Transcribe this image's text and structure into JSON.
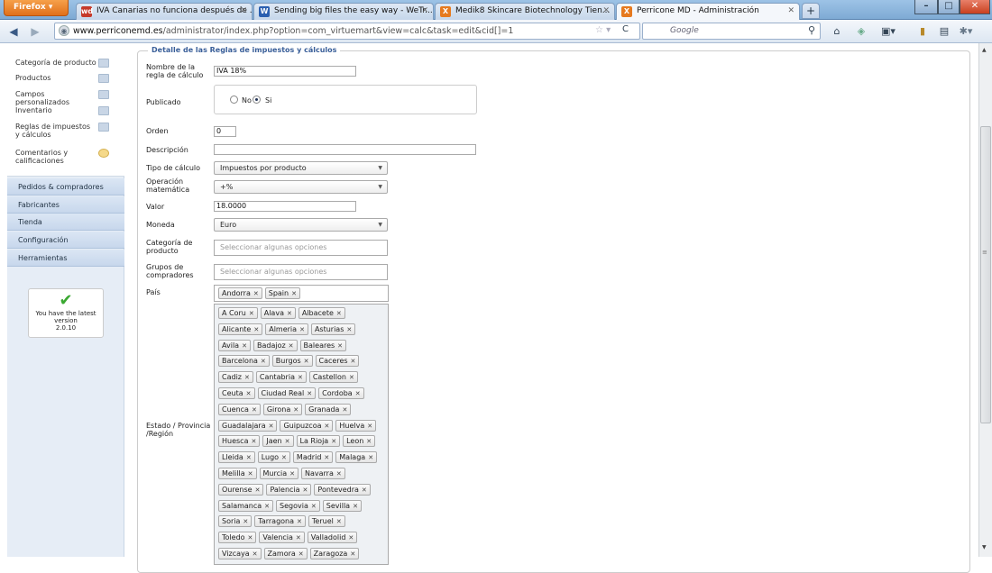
{
  "browser": {
    "menu_button": "Firefox ▾",
    "tabs": [
      {
        "title": "IVA Canarias no funciona después de ...",
        "icon": "wd",
        "color": "#c63a2a"
      },
      {
        "title": "Sending big files the easy way - WeTr...",
        "icon": "W",
        "color": "#2a5fb0"
      },
      {
        "title": "Medik8 Skincare Biotechnology Tien...",
        "icon": "X",
        "color": "#e67a1f"
      },
      {
        "title": "Perricone MD - Administración",
        "icon": "X",
        "color": "#e67a1f",
        "active": true
      }
    ],
    "new_tab": "+",
    "window_controls": [
      "–",
      "□",
      "✕"
    ],
    "url_host": "www.perriconemd.es",
    "url_path": "/administrator/index.php?option=com_virtuemart&view=calc&task=edit&cid[]=1",
    "search_placeholder": "Google",
    "toolbar_icons": [
      "home-icon",
      "addon-icon",
      "bookmarks-menu-icon",
      "library-icon",
      "screenshot-icon",
      "tools-icon"
    ]
  },
  "sidebar": {
    "product_items": [
      {
        "label": "Categoría de producto"
      },
      {
        "label": "Productos"
      },
      {
        "label": "Campos personalizados"
      },
      {
        "label": "Inventario"
      },
      {
        "label": "Reglas de impuestos y cálculos"
      },
      {
        "label": "Comentarios y calificaciones"
      }
    ],
    "sections": [
      "Pedidos & compradores",
      "Fabricantes",
      "Tienda",
      "Configuración",
      "Herramientas"
    ],
    "version_text": "You have the latest version",
    "version_number": "2.0.10"
  },
  "form": {
    "legend": "Detalle de las Reglas de impuestos y cálculos",
    "name": {
      "label": "Nombre de la regla de cálculo",
      "value": "IVA 18%"
    },
    "published": {
      "label": "Publicado",
      "no_label": "No",
      "yes_label": "Si",
      "selected": "Si"
    },
    "order": {
      "label": "Orden",
      "value": "0"
    },
    "description": {
      "label": "Descripción",
      "value": ""
    },
    "calc_type": {
      "label": "Tipo de cálculo",
      "value": "Impuestos por producto"
    },
    "math_op": {
      "label": "Operación matemática",
      "value": "+%"
    },
    "value": {
      "label": "Valor",
      "value": "18.0000"
    },
    "currency": {
      "label": "Moneda",
      "value": "Euro"
    },
    "product_category": {
      "label": "Categoría de producto",
      "placeholder": "Seleccionar algunas opciones"
    },
    "shopper_groups": {
      "label": "Grupos de compradores",
      "placeholder": "Seleccionar algunas opciones"
    },
    "country": {
      "label": "País",
      "chips": [
        "Andorra",
        "Spain"
      ]
    },
    "region": {
      "label": "Estado / Provincia /Región",
      "rows": [
        [
          "A Coru",
          "Alava",
          "Albacete"
        ],
        [
          "Alicante",
          "Almeria",
          "Asturias"
        ],
        [
          "Avila",
          "Badajoz",
          "Baleares"
        ],
        [
          "Barcelona",
          "Burgos",
          "Caceres"
        ],
        [
          "Cadiz",
          "Cantabria",
          "Castellon"
        ],
        [
          "Ceuta",
          "Ciudad Real",
          "Cordoba"
        ],
        [
          "Cuenca",
          "Girona",
          "Granada"
        ],
        [
          "Guadalajara",
          "Guipuzcoa",
          "Huelva"
        ],
        [
          "Huesca",
          "Jaen",
          "La Rioja",
          "Leon"
        ],
        [
          "Lleida",
          "Lugo",
          "Madrid",
          "Malaga"
        ],
        [
          "Melilla",
          "Murcia",
          "Navarra"
        ],
        [
          "Ourense",
          "Palencia",
          "Pontevedra"
        ],
        [
          "Salamanca",
          "Segovia",
          "Sevilla"
        ],
        [
          "Soria",
          "Tarragona",
          "Teruel"
        ],
        [
          "Toledo",
          "Valencia",
          "Valladolid"
        ],
        [
          "Vizcaya",
          "Zamora",
          "Zaragoza"
        ]
      ]
    }
  }
}
